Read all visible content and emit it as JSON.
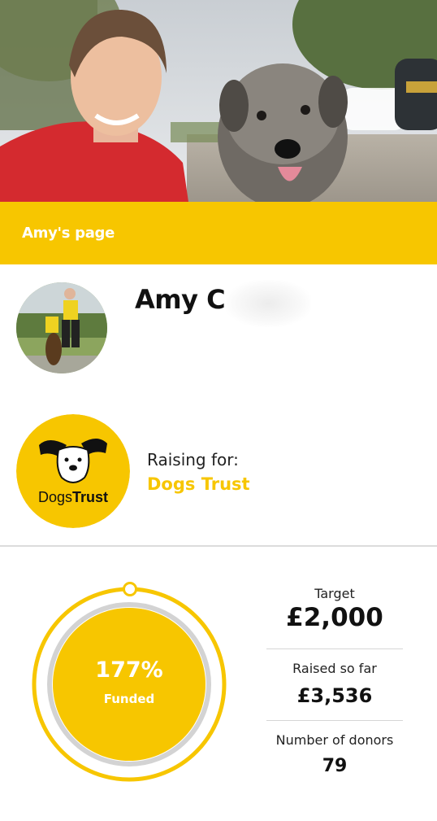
{
  "page": {
    "banner_title": "Amy's page",
    "fundraiser_name": "Amy C"
  },
  "charity": {
    "raising_label": "Raising for:",
    "name": "Dogs Trust",
    "logo_text_a": "Dogs",
    "logo_text_b": "Trust"
  },
  "progress": {
    "percent_label": "177%",
    "status_label": "Funded",
    "fraction": 1.77
  },
  "stats": {
    "target_label": "Target",
    "target_value": "£2,000",
    "raised_label": "Raised so far",
    "raised_value": "£3,536",
    "donors_label": "Number of donors",
    "donors_value": "79"
  },
  "colors": {
    "brand_yellow": "#f7c600",
    "ring_grey": "#d3d3d3"
  }
}
